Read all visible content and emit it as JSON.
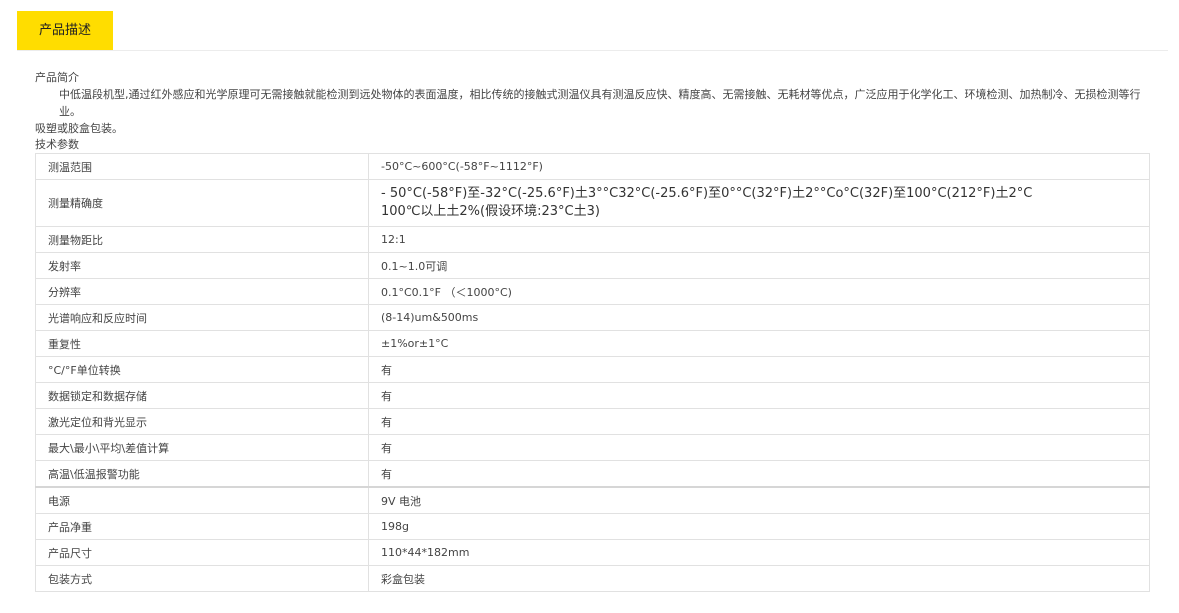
{
  "tab": {
    "label": "产品描述",
    "color": "#ffdd00"
  },
  "intro": {
    "heading": "产品简介",
    "body": "中低温段机型,通过红外感应和光学原理可无需接触就能检测到远处物体的表面温度，相比传统的接触式测温仪具有测温反应快、精度高、无需接触、无耗材等优点，广泛应用于化学化工、环境检测、加热制冷、无损检测等行业。",
    "note": "吸塑或胶盒包装。"
  },
  "specs": {
    "heading": "技术参数",
    "rows": [
      {
        "label": "测温范围",
        "value": "-50°C~600°C(-58°F~1112°F)"
      },
      {
        "label": "测量精确度",
        "value": "- 50°C(-58°F)至-32°C(-25.6°F)土3°°C32°C(-25.6°F)至0°°C(32°F)土2°°Co°C(32F)至100°C(212°F)土2°C",
        "value2": "100℃以上土2%(假设环境:23°C土3)"
      },
      {
        "label": "测量物距比",
        "value": "12:1"
      },
      {
        "label": "发射率",
        "value": "0.1~1.0可调"
      },
      {
        "label": "分辨率",
        "value": "0.1°C0.1°F （＜1000°C)"
      },
      {
        "label": "光谱响应和反应时间",
        "value": "(8-14)um&500ms"
      },
      {
        "label": "重复性",
        "value": "±1%or±1°C"
      },
      {
        "label": "°C/°F单位转换",
        "value": "有"
      },
      {
        "label": "数据锁定和数据存储",
        "value": "有"
      },
      {
        "label": "激光定位和背光显示",
        "value": "有"
      },
      {
        "label": "最大\\最小\\平均\\差值计算",
        "value": "有"
      },
      {
        "label": "高温\\低温报警功能",
        "value": "有"
      },
      {
        "label": "电源",
        "value": "9V  电池"
      },
      {
        "label": "产品净重",
        "value": "198g"
      },
      {
        "label": "产品尺寸",
        "value": "110*44*182mm"
      },
      {
        "label": "包装方式",
        "value": "彩盒包装"
      }
    ]
  }
}
